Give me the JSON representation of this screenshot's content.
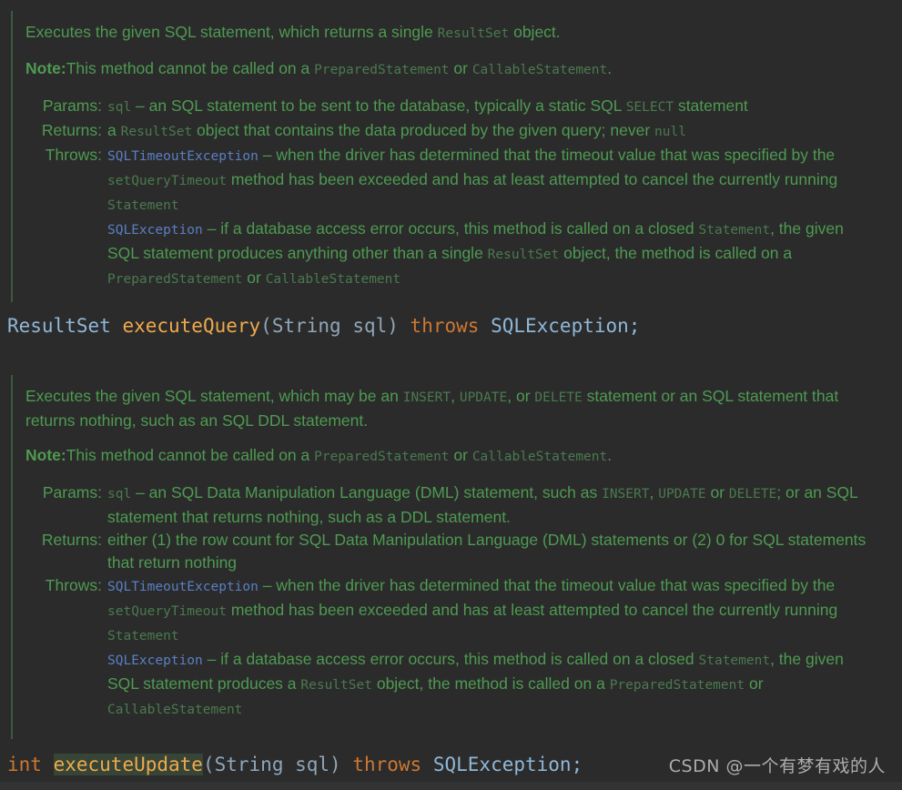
{
  "theme": {
    "background": "#2b2b2b",
    "doc_text": "#4e9a51",
    "inline_code": "#4a7a4e",
    "link": "#5a7fc4",
    "rule": "#3d5a40",
    "keyword": "#cc7832",
    "method_name": "#f0a94c",
    "type_name": "#8fb8d9",
    "punctuation": "#8fa6b8",
    "highlight": "#364536",
    "watermark_text": "#b9b9b9"
  },
  "blocks": [
    {
      "id": "execute-query-doc",
      "summary": {
        "pre": "Executes the given SQL statement, which returns a single ",
        "code1": "ResultSet",
        "post": " object."
      },
      "note": {
        "label": "Note:",
        "pre": "This method cannot be called on a ",
        "code1": "PreparedStatement",
        "mid": " or ",
        "code2": "CallableStatement",
        "post": "."
      },
      "params": {
        "label": "Params:",
        "name": "sql",
        "dash": " – ",
        "text_pre": "an SQL statement to be sent to the database, typically a static SQL ",
        "code1": "SELECT",
        "text_post": " statement"
      },
      "returns": {
        "label": "Returns:",
        "pre": "a ",
        "code1": "ResultSet",
        "mid": " object that contains the data produced by the given query; never ",
        "code2": "null"
      },
      "throws": {
        "label": "Throws:",
        "items": [
          {
            "exception": "SQLTimeoutException",
            "dash": " – ",
            "segments": [
              {
                "kind": "text",
                "value": "when the driver has determined that the timeout value that was specified by the "
              },
              {
                "kind": "code",
                "value": "setQueryTimeout"
              },
              {
                "kind": "text",
                "value": " method has been exceeded and has at least attempted to cancel the currently running "
              },
              {
                "kind": "code",
                "value": "Statement"
              }
            ]
          },
          {
            "exception": "SQLException",
            "dash": " – ",
            "segments": [
              {
                "kind": "text",
                "value": "if a database access error occurs, this method is called on a closed "
              },
              {
                "kind": "code",
                "value": "Statement"
              },
              {
                "kind": "text",
                "value": ", the given SQL statement produces anything other than a single "
              },
              {
                "kind": "code",
                "value": "ResultSet"
              },
              {
                "kind": "text",
                "value": " object, the method is called on a "
              },
              {
                "kind": "code",
                "value": "PreparedStatement"
              },
              {
                "kind": "text",
                "value": " or "
              },
              {
                "kind": "code",
                "value": "CallableStatement"
              }
            ]
          }
        ]
      }
    },
    {
      "id": "execute-update-doc",
      "summary": {
        "pre": "Executes the given SQL statement, which may be an ",
        "code1": "INSERT",
        "sep1": ", ",
        "code2": "UPDATE",
        "sep2": ", or ",
        "code3": "DELETE",
        "post": " statement or an SQL statement that returns nothing, such as an SQL DDL statement."
      },
      "note": {
        "label": "Note:",
        "pre": "This method cannot be called on a ",
        "code1": "PreparedStatement",
        "mid": " or ",
        "code2": "CallableStatement",
        "post": "."
      },
      "params": {
        "label": "Params:",
        "name": "sql",
        "dash": " – ",
        "text_pre": "an SQL Data Manipulation Language (DML) statement, such as ",
        "code1": "INSERT",
        "sep1": ", ",
        "code2": "UPDATE",
        "sep2": " or ",
        "code3": "DELETE",
        "text_post": "; or an SQL statement that returns nothing, such as a DDL statement."
      },
      "returns": {
        "label": "Returns:",
        "text": "either (1) the row count for SQL Data Manipulation Language (DML) statements or (2) 0 for SQL statements that return nothing"
      },
      "throws": {
        "label": "Throws:",
        "items": [
          {
            "exception": "SQLTimeoutException",
            "dash": " – ",
            "segments": [
              {
                "kind": "text",
                "value": "when the driver has determined that the timeout value that was specified by the "
              },
              {
                "kind": "code",
                "value": "setQueryTimeout"
              },
              {
                "kind": "text",
                "value": " method has been exceeded and has at least attempted to cancel the currently running "
              },
              {
                "kind": "code",
                "value": "Statement"
              }
            ]
          },
          {
            "exception": "SQLException",
            "dash": " – ",
            "segments": [
              {
                "kind": "text",
                "value": "if a database access error occurs, this method is called on a closed "
              },
              {
                "kind": "code",
                "value": "Statement"
              },
              {
                "kind": "text",
                "value": ", the given SQL statement produces a "
              },
              {
                "kind": "code",
                "value": "ResultSet"
              },
              {
                "kind": "text",
                "value": " object, the method is called on a "
              },
              {
                "kind": "code",
                "value": "PreparedStatement"
              },
              {
                "kind": "text",
                "value": " or "
              },
              {
                "kind": "code",
                "value": "CallableStatement"
              }
            ]
          }
        ]
      }
    }
  ],
  "signatures": [
    {
      "id": "execute-query-signature",
      "return_type": "ResultSet",
      "space1": " ",
      "method": "executeQuery",
      "params": "(String sql)",
      "space2": " ",
      "keyword": "throws",
      "space3": " ",
      "exception": "SQLException;",
      "method_highlighted": false
    },
    {
      "id": "execute-update-signature",
      "return_type": "int",
      "space1": " ",
      "method": "executeUpdate",
      "params": "(String sql)",
      "space2": " ",
      "keyword": "throws",
      "space3": " ",
      "exception": "SQLException;",
      "method_highlighted": true
    }
  ],
  "watermark": {
    "text": "CSDN @一个有梦有戏的人"
  }
}
